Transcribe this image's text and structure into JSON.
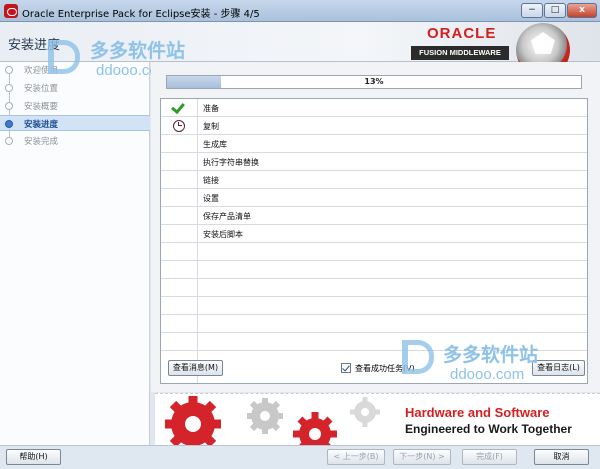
{
  "window": {
    "title": "Oracle Enterprise Pack for Eclipse安装 - 步骤 4/5",
    "controls": [
      "−",
      "□",
      "x"
    ]
  },
  "header": {
    "page_title": "安装进度",
    "logo_text": "ORACLE",
    "logo_subtitle": "FUSION MIDDLEWARE"
  },
  "steps": [
    {
      "label": "欢迎使用",
      "state": "done"
    },
    {
      "label": "安装位置",
      "state": "done"
    },
    {
      "label": "安装概要",
      "state": "done"
    },
    {
      "label": "安装进度",
      "state": "active"
    },
    {
      "label": "安装完成",
      "state": "pending"
    }
  ],
  "watermark": {
    "top_text": "多多软件站",
    "top_url": "ddooo.com",
    "bottom_text": "多多软件站",
    "bottom_url": "ddooo.com"
  },
  "progress": {
    "value": 0.13,
    "label": "13%"
  },
  "tasks": [
    {
      "name": "准备",
      "status": "done"
    },
    {
      "name": "复制",
      "status": "in-progress"
    },
    {
      "name": "生成库",
      "status": "pending"
    },
    {
      "name": "执行字符串替换",
      "status": "pending"
    },
    {
      "name": "链接",
      "status": "pending"
    },
    {
      "name": "设置",
      "status": "pending"
    },
    {
      "name": "保存产品清单",
      "status": "pending"
    },
    {
      "name": "安装后脚本",
      "status": "pending"
    }
  ],
  "actions": {
    "view_messages": "查看消息(M)",
    "show_successful_tasks": "查看成功任务(V)",
    "show_successful_checked": true,
    "view_log": "查看日志(L)"
  },
  "banner": {
    "line1": "Hardware and Software",
    "line2": "Engineered to Work Together"
  },
  "footer": {
    "help": "帮助(H)",
    "back": "< 上一步(B)",
    "next": "下一步(N) >",
    "finish": "完成(F)",
    "cancel": "取消"
  },
  "colors": {
    "accent_red": "#d21f1f",
    "active_step_bg": "#d3e3f6",
    "check_green": "#2e9b2a"
  }
}
